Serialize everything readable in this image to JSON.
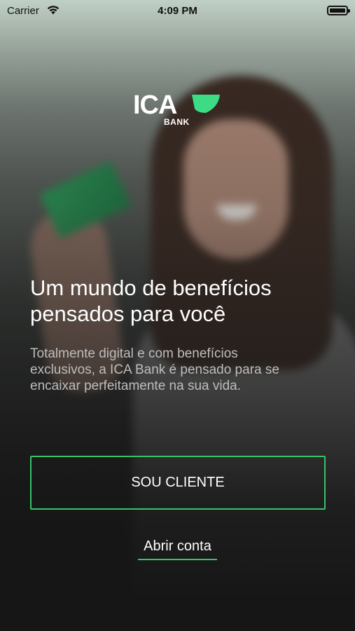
{
  "status_bar": {
    "carrier": "Carrier",
    "time": "4:09 PM"
  },
  "logo": {
    "name": "ICA",
    "sub": "BANK",
    "accent_color": "#3ddc84"
  },
  "hero": {
    "headline_line1": "Um mundo de benefícios",
    "headline_line2": "pensados para você",
    "desc_line1": "Totalmente digital e com benefícios",
    "desc_line2": "exclusivos, a ICA Bank é pensado para se",
    "desc_line3": "encaixar perfeitamente na sua vida."
  },
  "actions": {
    "client_button": "SOU CLIENTE",
    "open_account_link": "Abrir conta"
  },
  "colors": {
    "accent": "#35c46a",
    "background_dark": "#161616"
  }
}
